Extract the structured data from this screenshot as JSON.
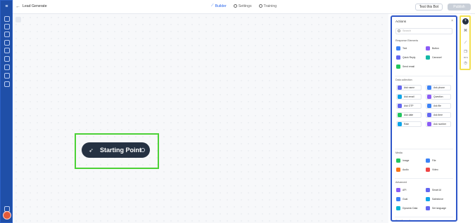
{
  "app": {
    "name": "Lead Generate",
    "back_icon": "arrow-left-icon"
  },
  "tabs": [
    {
      "label": "Builder",
      "icon": "flow-icon",
      "active": true
    },
    {
      "label": "Settings",
      "icon": "gear-icon",
      "active": false
    },
    {
      "label": "Training",
      "icon": "target-icon",
      "active": false
    }
  ],
  "header_buttons": {
    "test": "Test this Bot",
    "publish": "Publish"
  },
  "sidebar": {
    "icons": [
      "home-icon",
      "chart-icon",
      "chat-icon",
      "integrations-icon",
      "settings-icon",
      "book-icon",
      "message-icon",
      "inbox-icon"
    ],
    "bottom": [
      "help-icon",
      "avatar"
    ]
  },
  "canvas": {
    "start_node_label": "Starting Point",
    "start_node_icon": "rocket-icon"
  },
  "actions_panel": {
    "title": "Actions",
    "search_placeholder": "Search",
    "sections": [
      {
        "title": "Response Elements",
        "items": [
          {
            "label": "Text",
            "color": "#3b82f6"
          },
          {
            "label": "Button",
            "color": "#8b5cf6"
          },
          {
            "label": "Quick Reply",
            "color": "#6366f1"
          },
          {
            "label": "Carousel",
            "color": "#14b8a6"
          },
          {
            "label": "Send email",
            "color": "#22c55e"
          }
        ]
      },
      {
        "title": "Data collection",
        "items": [
          {
            "label": "Ask name",
            "color": "#6366f1"
          },
          {
            "label": "Ask phone",
            "color": "#3b82f6"
          },
          {
            "label": "Ask email",
            "color": "#0ea5e9"
          },
          {
            "label": "Question",
            "color": "#8b5cf6"
          },
          {
            "label": "Ask OTP",
            "color": "#6366f1"
          },
          {
            "label": "Ask file",
            "color": "#3b82f6"
          },
          {
            "label": "Ask date",
            "color": "#22c55e"
          },
          {
            "label": "Ask time",
            "color": "#6366f1"
          },
          {
            "label": "Rate",
            "color": "#0ea5e9"
          },
          {
            "label": "Ask number",
            "color": "#8b5cf6"
          }
        ]
      },
      {
        "title": "Media",
        "items": [
          {
            "label": "Image",
            "color": "#22c55e"
          },
          {
            "label": "File",
            "color": "#3b82f6"
          },
          {
            "label": "Audio",
            "color": "#f97316"
          },
          {
            "label": "Video",
            "color": "#ef4444"
          }
        ]
      },
      {
        "title": "Advanced",
        "items": [
          {
            "label": "API",
            "color": "#8b5cf6"
          },
          {
            "label": "Smart AI",
            "color": "#6366f1"
          },
          {
            "label": "Goal",
            "color": "#3b82f6"
          },
          {
            "label": "Salesforce",
            "color": "#0ea5e9"
          },
          {
            "label": "Dynamic Data",
            "color": "#06b6d4"
          },
          {
            "label": "Set language",
            "color": "#6366f1"
          }
        ]
      },
      {
        "title": "Workflow actions",
        "items": [
          {
            "label": "Condition",
            "color": "#3b82f6"
          },
          {
            "label": "Chat operator",
            "color": "#f97316"
          }
        ]
      }
    ]
  },
  "right_toolbar": {
    "items": [
      "plus-icon",
      "broom-icon",
      "magic-wand-icon",
      "copy-icon",
      "zoom-icon",
      "history-icon"
    ],
    "zoom_label": "80%"
  },
  "colors": {
    "sidebar": "#1f4fa8",
    "accent": "#2563eb",
    "node": "#253142",
    "green_highlight": "#4cd137",
    "blue_highlight": "#2d55c8",
    "yellow_highlight": "#f3e04f"
  }
}
